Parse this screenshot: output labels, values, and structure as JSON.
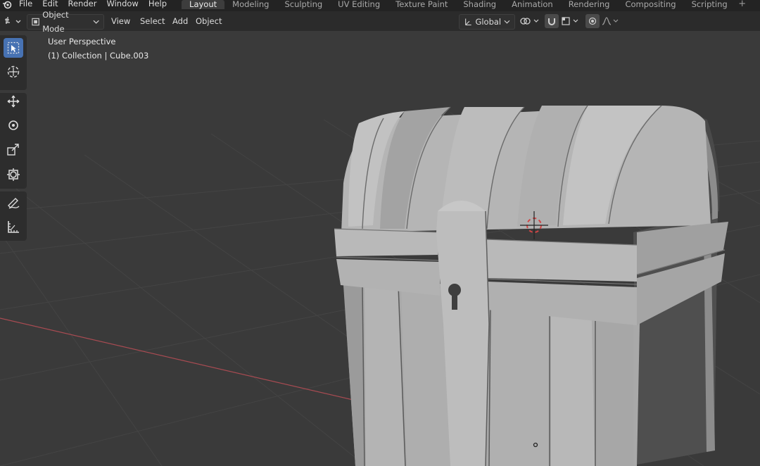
{
  "topbar": {
    "menus": [
      "File",
      "Edit",
      "Render",
      "Window",
      "Help"
    ],
    "tabs": [
      "Layout",
      "Modeling",
      "Sculpting",
      "UV Editing",
      "Texture Paint",
      "Shading",
      "Animation",
      "Rendering",
      "Compositing",
      "Scripting"
    ],
    "active_tab": "Layout",
    "add_tab": "+"
  },
  "header": {
    "mode": "Object Mode",
    "menus": [
      "View",
      "Select",
      "Add",
      "Object"
    ],
    "transform_orientation": "Global"
  },
  "viewport": {
    "view_name": "User Perspective",
    "collection_label": "(1) Collection | Cube.003"
  },
  "toolbar": {
    "tools": [
      "select-box-icon",
      "cursor-icon",
      "move-icon",
      "rotate-icon",
      "scale-icon",
      "transform-icon",
      "annotate-icon",
      "measure-icon"
    ],
    "active_tool": "select-box-icon"
  },
  "colors": {
    "accent": "#4772b3",
    "viewport_bg": "#3a3a3a",
    "x_axis": "#a84b52"
  }
}
